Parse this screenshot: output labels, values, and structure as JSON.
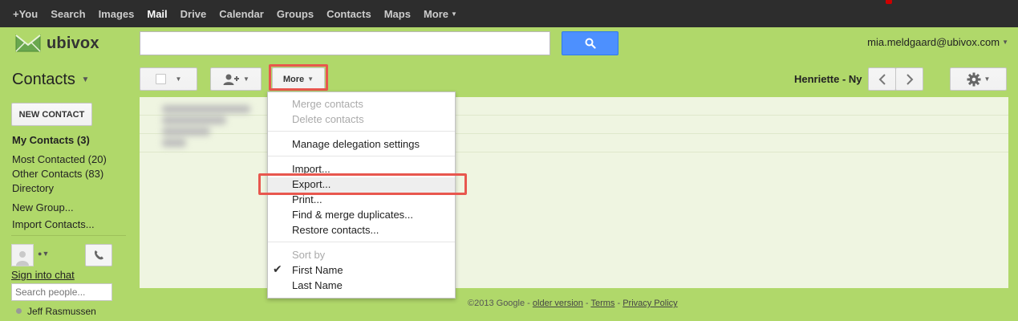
{
  "topbar": {
    "items": [
      {
        "label": "+You",
        "active": false
      },
      {
        "label": "Search",
        "active": false
      },
      {
        "label": "Images",
        "active": false
      },
      {
        "label": "Mail",
        "active": true
      },
      {
        "label": "Drive",
        "active": false
      },
      {
        "label": "Calendar",
        "active": false
      },
      {
        "label": "Groups",
        "active": false
      },
      {
        "label": "Contacts",
        "active": false
      },
      {
        "label": "Maps",
        "active": false
      }
    ],
    "more_label": "More"
  },
  "header": {
    "logo_text": "ubivox",
    "search_value": "",
    "account_email": "mia.meldgaard@ubivox.com"
  },
  "toolbar": {
    "app_title": "Contacts",
    "more_label": "More",
    "pager_name": "Henriette - Ny"
  },
  "sidebar": {
    "new_contact_label": "NEW CONTACT",
    "my_contacts": "My Contacts (3)",
    "most_contacted": "Most Contacted (20)",
    "other_contacts": "Other Contacts (83)",
    "directory": "Directory",
    "new_group": "New Group...",
    "import_contacts": "Import Contacts...",
    "chat": {
      "sign_in": "Sign into chat",
      "search_placeholder": "Search people...",
      "contact_name": "Jeff Rasmussen"
    }
  },
  "more_menu": {
    "merge": "Merge contacts",
    "delete": "Delete contacts",
    "delegation": "Manage delegation settings",
    "import": "Import...",
    "export": "Export...",
    "print": "Print...",
    "find_merge": "Find & merge duplicates...",
    "restore": "Restore contacts...",
    "sort_by": "Sort by",
    "first_name": "First Name",
    "last_name": "Last Name",
    "selected_sort": "First Name"
  },
  "footer": {
    "copyright": "©2013 Google",
    "older_version": "older version",
    "terms": "Terms",
    "privacy": "Privacy Policy",
    "sep": " - "
  },
  "colors": {
    "background": "#b0d86a",
    "topbar": "#2d2d2d",
    "search_button": "#4d90fe",
    "highlight": "#e8574e"
  }
}
